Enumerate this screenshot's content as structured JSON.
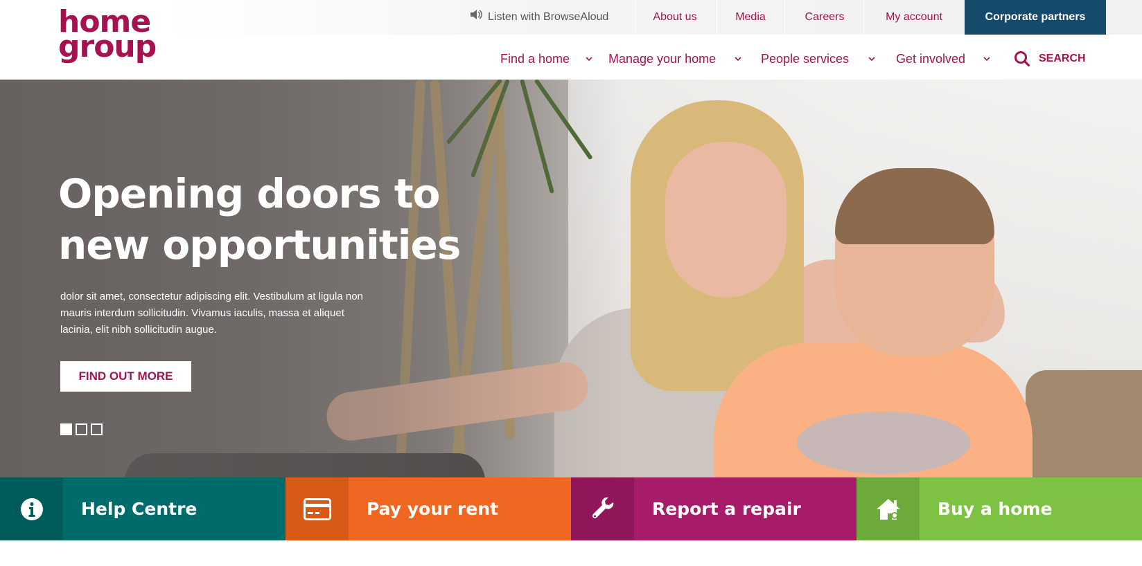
{
  "logo": {
    "line1": "home",
    "line2": "group"
  },
  "utility": {
    "browsealoud": "Listen with BrowseAloud",
    "about": "About us",
    "media": "Media",
    "careers": "Careers",
    "account": "My account",
    "corporate": "Corporate partners"
  },
  "nav": {
    "items": [
      {
        "label": "Find a home"
      },
      {
        "label": "Manage your home"
      },
      {
        "label": "People services"
      },
      {
        "label": "Get involved"
      }
    ],
    "search_label": "SEARCH"
  },
  "hero": {
    "title_line1": "Opening doors to",
    "title_line2": "new opportunities",
    "text": "dolor sit amet, consectetur adipiscing elit. Vestibulum at ligula non mauris interdum sollicitudin. Vivamus iaculis, massa et aliquet lacinia, elit nibh sollicitudin augue.",
    "button": "FIND OUT MORE",
    "slides": 3,
    "active_slide": 1
  },
  "tiles": [
    {
      "label": "Help Centre",
      "icon": "info-icon",
      "color": "#006b6b",
      "icon_bg": "#005b5b"
    },
    {
      "label": "Pay your rent",
      "icon": "card-icon",
      "color": "#f06722",
      "icon_bg": "#d95a17"
    },
    {
      "label": "Report a repair",
      "icon": "wrench-icon",
      "color": "#a61c69",
      "icon_bg": "#8f1659"
    },
    {
      "label": "Buy a home",
      "icon": "house-icon",
      "color": "#7dc243",
      "icon_bg": "#6ea93c"
    }
  ],
  "colors": {
    "brand": "#a6124f",
    "corporate": "#164a6b"
  }
}
